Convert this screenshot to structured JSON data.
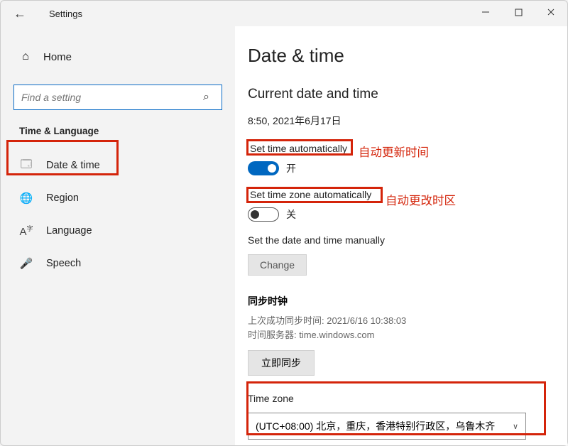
{
  "titlebar": {
    "title": "Settings"
  },
  "sidebar": {
    "home": "Home",
    "search_placeholder": "Find a setting",
    "group_title": "Time & Language",
    "items": [
      {
        "label": "Date & time"
      },
      {
        "label": "Region"
      },
      {
        "label": "Language"
      },
      {
        "label": "Speech"
      }
    ]
  },
  "main": {
    "title": "Date & time",
    "current_section": "Current date and time",
    "current_value": "8:50, 2021年6月17日",
    "set_time_auto_label": "Set time automatically",
    "set_time_auto_state": "开",
    "set_tz_auto_label": "Set time zone automatically",
    "set_tz_auto_state": "关",
    "manual_label": "Set the date and time manually",
    "change_btn": "Change",
    "sync_title": "同步时钟",
    "sync_last": "上次成功同步时间: 2021/6/16 10:38:03",
    "sync_server": "时间服务器: time.windows.com",
    "sync_btn": "立即同步",
    "tz_label": "Time zone",
    "tz_value": "(UTC+08:00) 北京，重庆，香港特别行政区，乌鲁木齐"
  },
  "annotations": {
    "a1": "自动更新时间",
    "a2": "自动更改时区"
  }
}
